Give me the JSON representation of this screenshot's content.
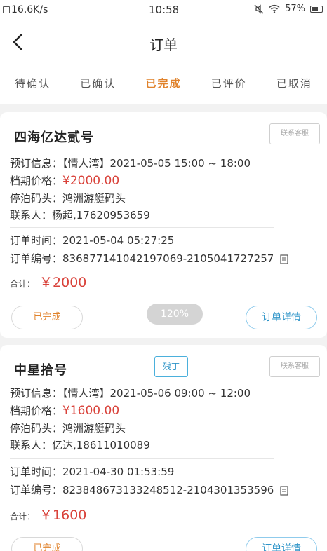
{
  "status_bar": {
    "speed": "16.6K/s",
    "time": "10:58",
    "battery": "57%"
  },
  "nav": {
    "title": "订单"
  },
  "tabs": [
    {
      "label": "待确认"
    },
    {
      "label": "已确认"
    },
    {
      "label": "已完成",
      "active": true
    },
    {
      "label": "已评价"
    },
    {
      "label": "已取消"
    }
  ],
  "orders": [
    {
      "company": "四海亿达贰号",
      "contact_label": "联系客服",
      "booking_label": "预订信息：",
      "booking_value": "【情人湾】2021-05-05 15:00 ~ 18:00",
      "price_label": "档期价格：",
      "price": "¥2000.00",
      "dock_label": "停泊码头：",
      "dock": "鸿洲游艇码头",
      "contact_person_label": "联系人：",
      "contact_person": "杨超,17620953659",
      "order_time_label": "订单时间：",
      "order_time": "2021-05-04 05:27:25",
      "order_no_label": "订单编号：",
      "order_no": "836877141042197069-2105041727257",
      "total_label": "合计：",
      "total": "￥2000",
      "status_button": "已完成",
      "detail_button": "订单详情"
    },
    {
      "company": "中星拾号",
      "tag": "残丁",
      "contact_label": "联系客服",
      "booking_label": "预订信息：",
      "booking_value": "【情人湾】2021-05-06 09:00 ~ 12:00",
      "price_label": "档期价格：",
      "price": "¥1600.00",
      "dock_label": "停泊码头：",
      "dock": "鸿洲游艇码头",
      "contact_person_label": "联系人：",
      "contact_person": "亿达,18611010089",
      "order_time_label": "订单时间：",
      "order_time": "2021-04-30 01:53:59",
      "order_no_label": "订单编号：",
      "order_no": "823848673133248512-2104301353596",
      "total_label": "合计：",
      "total": "￥1600",
      "status_button": "已完成",
      "detail_button": "订单详情"
    }
  ],
  "zoom_badge": "120%",
  "colors": {
    "accent_orange": "#e0822b",
    "price_red": "#d9423a",
    "link_blue": "#2e94c8"
  }
}
